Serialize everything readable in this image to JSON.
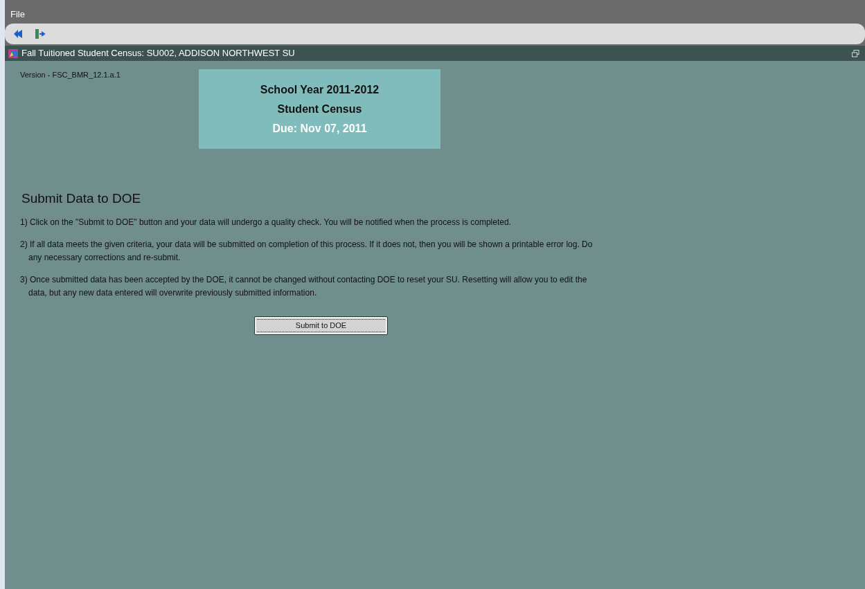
{
  "menu": [
    "File"
  ],
  "window": {
    "title": "Fall Tuitioned Student Census:  SU002, ADDISON NORTHWEST SU"
  },
  "version": "Version - FSC_BMR_12.1.a.1",
  "banner": {
    "line1": "School Year 2011-2012",
    "line2": "Student Census",
    "due": "Due:  Nov 07, 2011"
  },
  "heading": "Submit Data to DOE",
  "steps": [
    "1) Click on the \"Submit to DOE\"  button and your data will undergo a quality check.   You will be notified when the process is completed.",
    "2) If all data meets the given criteria, your data will be submitted on completion of this process.  If it  does not, then you will be shown a printable error log.  Do any necessary corrections and re-submit.",
    "3) Once submitted data has been accepted by the DOE, it cannot be changed without contacting DOE to reset your SU.  Resetting will allow you to edit the data, but any new data entered will overwrite previously submitted information."
  ],
  "submit_button": "Submit to DOE"
}
